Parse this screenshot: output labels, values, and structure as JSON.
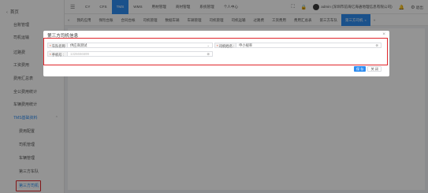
{
  "sidebar": {
    "home": "首页",
    "items": [
      {
        "label": "台账管理"
      },
      {
        "label": "司机运输"
      },
      {
        "label": "过路费"
      },
      {
        "label": "工资费用"
      },
      {
        "label": "费用汇总表"
      },
      {
        "label": "全公费用统计"
      },
      {
        "label": "车辆费用统计"
      }
    ],
    "group": {
      "label": "TMS基础资料"
    },
    "sub_items": [
      {
        "label": "费用配置"
      },
      {
        "label": "司机管理"
      },
      {
        "label": "车辆管理"
      },
      {
        "label": "第三方车队"
      },
      {
        "label": "第三方司机"
      }
    ]
  },
  "topnav": {
    "items": [
      {
        "label": "CY"
      },
      {
        "label": "CFS"
      },
      {
        "label": "TMS",
        "active": true
      },
      {
        "label": "WMS"
      },
      {
        "label": "用材管理"
      },
      {
        "label": "商材管理"
      },
      {
        "label": "系统管理"
      },
      {
        "label": "个人中心"
      }
    ],
    "user": "admin (深圳市前海亿海通地理信息有限公司)",
    "logout": "退出"
  },
  "tabs": {
    "items": [
      {
        "label": "我的应用"
      },
      {
        "label": "保险台账"
      },
      {
        "label": "合同台帐"
      },
      {
        "label": "司机管理"
      },
      {
        "label": "数据车辆"
      },
      {
        "label": "车辆管理"
      },
      {
        "label": "司机管理"
      },
      {
        "label": "司机运输"
      },
      {
        "label": "过路费"
      },
      {
        "label": "工资费用"
      },
      {
        "label": "费用汇总表"
      },
      {
        "label": "第三方车队"
      },
      {
        "label": "第三方司机",
        "active": true
      }
    ]
  },
  "table": {
    "op_header": "操作",
    "edit_label": "编辑",
    "delete_label": "删除"
  },
  "dialog": {
    "title": "第三方司机信息",
    "fields": {
      "fleet_name": {
        "label": "车队名称 :",
        "value": "供应商测试"
      },
      "driver_name": {
        "label": "司机姓名 :",
        "value": "申小规率"
      },
      "phone": {
        "label": "手机号 :",
        "value": "1326666699"
      }
    },
    "save_label": "保 存",
    "close_label": "关 闭"
  },
  "colors": {
    "primary": "#2d8cf0",
    "danger": "#ed3f14",
    "highlight": "#e0262b"
  }
}
